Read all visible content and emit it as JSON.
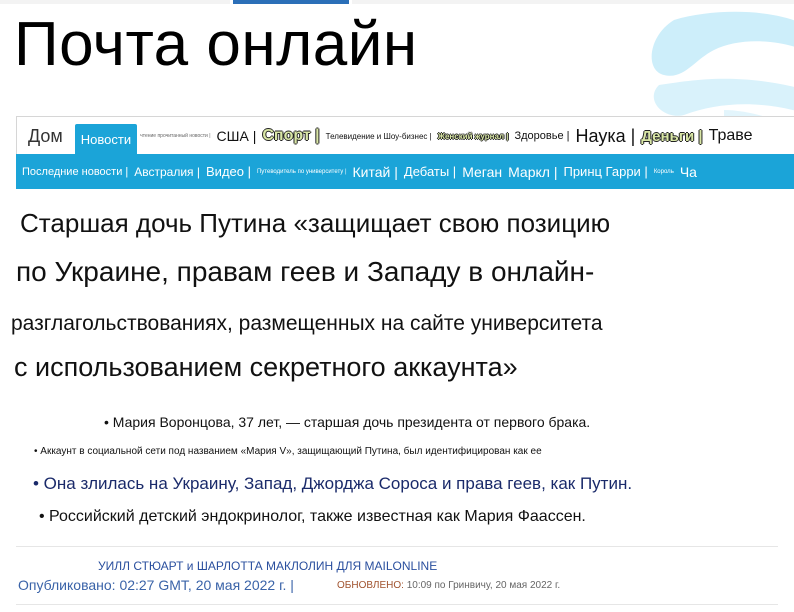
{
  "site": {
    "title": "Почта онлайн"
  },
  "nav_primary": [
    {
      "label": "Дом",
      "style": "home"
    },
    {
      "label": "Новости",
      "style": "active"
    },
    {
      "label": "чтение прочитанный новости |",
      "style": "tiny"
    },
    {
      "label": "США |",
      "style": "t14"
    },
    {
      "label": "Спорт |",
      "style": "sport"
    },
    {
      "label": "Телевидение и Шоу-бизнес |",
      "style": "t10 tiny8"
    },
    {
      "label": "Женский журнал |",
      "style": "small"
    },
    {
      "label": "Здоровье |",
      "style": "t10 t11"
    },
    {
      "label": "Наука |",
      "style": "t18"
    },
    {
      "label": "Деньги |",
      "style": "money"
    },
    {
      "label": "Траве",
      "style": "t16"
    }
  ],
  "nav_secondary": [
    {
      "label": "Последние новости |",
      "size": "s11"
    },
    {
      "label": "Австралия |",
      "size": "s12"
    },
    {
      "label": "Видео |",
      "size": "s13"
    },
    {
      "label": "Путеводитель по университету |",
      "size": "s6"
    },
    {
      "label": "Китай |",
      "size": "s14"
    },
    {
      "label": "Дебаты |",
      "size": "s13"
    },
    {
      "label": "Меган",
      "size": "s14"
    },
    {
      "label": "Маркл |",
      "size": "s14"
    },
    {
      "label": "Принц Гарри |",
      "size": "s13"
    },
    {
      "label": "Король",
      "size": "s6"
    },
    {
      "label": "Ча",
      "size": "s14"
    }
  ],
  "article": {
    "headline_lines": [
      "Старшая дочь Путина «защищает свою позицию",
      "по Украине, правам геев и Западу в онлайн-",
      "разглагольствованиях, размещенных на сайте университета",
      "с использованием секретного аккаунта»"
    ],
    "bullets": [
      "• Мария Воронцова, 37 лет, — старшая дочь президента от первого брака.",
      "• Аккаунт в социальной сети под названием «Мария V», защищающий Путина, был идентифицирован как ее",
      "• Она злилась на Украину, Запад, Джорджа Сороса и права геев, как Путин.",
      "• Российский детский эндокринолог, также известная как Мария Фаассен."
    ],
    "byline": "УИЛЛ СТЮАРТ и ШАРЛОТТА МАКЛОЛИН ДЛЯ MAILONLINE",
    "published": "Опубликовано: 02:27 GMT, 20 мая 2022 г. |",
    "updated_label": "ОБНОВЛЕНО:",
    "updated_value": "10:09 по Гринвичу, 20 мая 2022 г."
  },
  "colors": {
    "nav_blue": "#1ba4d8",
    "byline_blue": "#2a4f9e",
    "updated_brown": "#a0522d",
    "deco_light_blue": "#cdeefa"
  }
}
